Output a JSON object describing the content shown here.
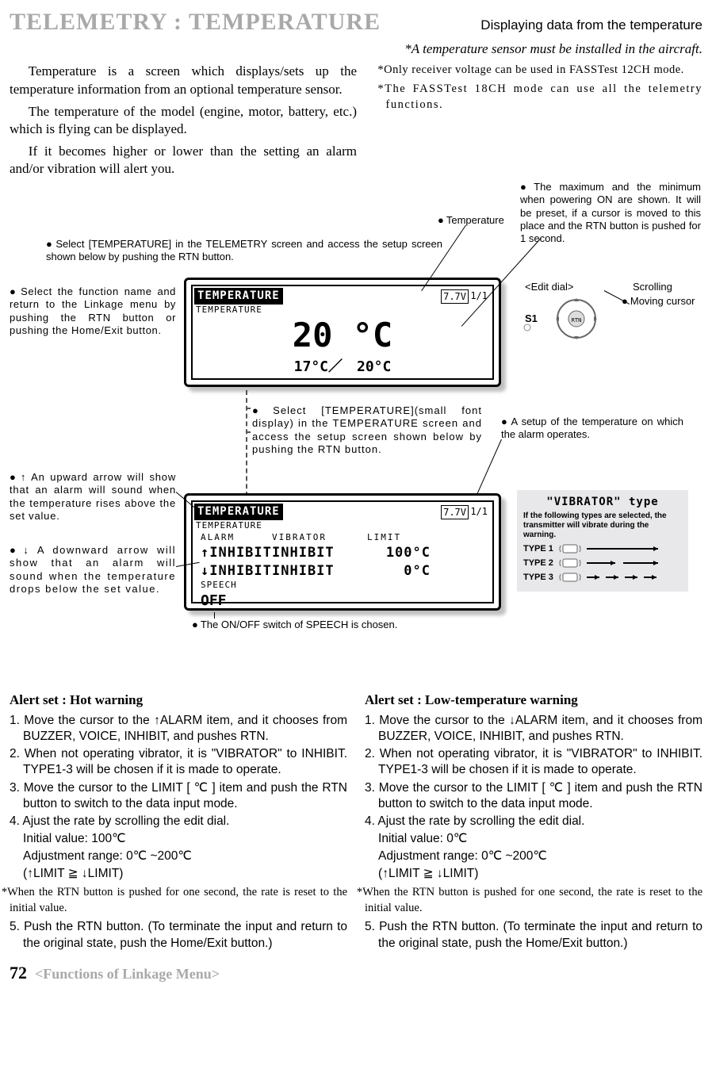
{
  "header": {
    "title": "TELEMETRY : TEMPERATURE",
    "subtitle": "Displaying data from the temperature",
    "install_note": "*A temperature sensor must be installed in the aircraft."
  },
  "intro_left": {
    "p1": "Temperature is a screen which displays/sets up the temperature information from an optional temperature sensor.",
    "p2": "The temperature of the model (engine,  motor, battery, etc.) which is flying can be displayed.",
    "p3": "If it becomes higher or lower than the setting  an alarm and/or vibration will alert you."
  },
  "intro_right": {
    "n1": "*Only receiver voltage can be used in FASSTest 12CH mode.",
    "n2": "*The FASSTest 18CH mode can use all the telemetry functions."
  },
  "callouts": {
    "temperature_label": "Temperature",
    "max_min": "The maximum and the minimum when powering ON are shown. It will be preset, if a cursor is moved to this place and the RTN button is pushed for 1 second.",
    "select_main": "Select [TEMPERATURE] in the TELEMETRY screen and access the setup screen shown below by pushing the RTN button.",
    "select_func_name": "Select the function name and return to the Linkage menu by pushing the RTN button or pushing the Home/Exit button.",
    "edit_dial": "<Edit dial>",
    "scrolling": "Scrolling",
    "moving_cursor": "Moving cursor",
    "s1_label": "S1",
    "select_small": "Select [TEMPERATURE](small font display) in the TEMPERATURE screen and access the setup screen shown below by pushing the RTN button.",
    "alarm_setup": "A setup of the temperature on which the alarm operates.",
    "up_arrow": "↑ An upward arrow will show that an alarm will sound when the temperature rises above the set value.",
    "down_arrow": "↓ A downward arrow will show that an alarm will sound when the temperature drops below the set value.",
    "speech_note": "The ON/OFF switch of SPEECH is chosen."
  },
  "lcd1": {
    "title": "TEMPERATURE",
    "sub": "TEMPERATURE",
    "vbatt": "7.7V",
    "page": "1/1",
    "big": "20 °C",
    "minmax": "17°C／　20°C"
  },
  "lcd2": {
    "title": "TEMPERATURE",
    "sub": "TEMPERATURE",
    "vbatt": "7.7V",
    "page": "1/1",
    "h_alarm": "ALARM",
    "h_vib": "VIBRATOR",
    "h_limit": "LIMIT",
    "r1a": "↑INHIBIT",
    "r1b": "INHIBIT",
    "r1c": "100°C",
    "r2a": "↓INHIBIT",
    "r2b": "INHIBIT",
    "r2c": "0°C",
    "speech_label": "SPEECH",
    "speech_val": "OFF"
  },
  "vibrator": {
    "title": "\"VIBRATOR\" type",
    "sub": "If the following types are selected, the transmitter will vibrate during the warning.",
    "t1": "TYPE 1",
    "t2": "TYPE 2",
    "t3": "TYPE 3"
  },
  "alert_hot": {
    "heading": "Alert set : Hot warning",
    "s1": "1. Move the cursor to the ↑ALARM  item, and it chooses from BUZZER, VOICE, INHIBIT, and pushes RTN.",
    "s2": "2. When not operating vibrator, it is \"VIBRATOR\" to INHIBIT. TYPE1-3 will be chosen if it is made to operate.",
    "s3": "3. Move the cursor to the LIMIT [  ℃ ] item and push the RTN button to switch to the data input mode.",
    "s4": "4. Ajust the rate by scrolling the edit dial.",
    "s4a": "Initial value: 100℃",
    "s4b": "Adjustment range: 0℃ ~200℃",
    "s4c": "(↑LIMIT ≧ ↓LIMIT)",
    "note": "*When the RTN button is pushed for one second, the rate is reset to the initial value.",
    "s5": "5. Push the RTN button. (To terminate the input and return to the original state, push the Home/Exit button.)"
  },
  "alert_low": {
    "heading": "Alert set : Low-temperature warning",
    "s1": "1. Move the cursor to the  ↓ALARM  item, and it chooses from BUZZER, VOICE, INHIBIT, and pushes RTN.",
    "s2": "2. When not operating vibrator, it is \"VIBRATOR\" to INHIBIT. TYPE1-3 will be chosen if it is made to operate.",
    "s3": "3. Move the cursor to the LIMIT [  ℃ ] item and push the RTN button to switch to the data input mode.",
    "s4": "4. Ajust the rate by scrolling the edit dial.",
    "s4a": "Initial value: 0℃",
    "s4b": "Adjustment range: 0℃ ~200℃",
    "s4c": "(↑LIMIT ≧ ↓LIMIT)",
    "note": "*When the RTN button is pushed for one second, the rate is reset to the initial value.",
    "s5": "5. Push the RTN button. (To terminate the input and return to the original state, push the Home/Exit button.)"
  },
  "footer": {
    "page": "72",
    "section": "<Functions of Linkage Menu>"
  }
}
